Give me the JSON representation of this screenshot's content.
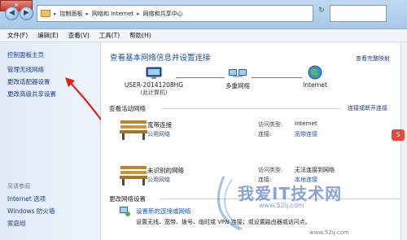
{
  "address": {
    "crumbs": [
      "控制面板",
      "网络和 Internet",
      "网络和共享中心"
    ]
  },
  "menu": [
    "文件(F)",
    "编辑(E)",
    "查看(V)",
    "工具(T)",
    "帮助(H)"
  ],
  "left": {
    "home": "控制面板主页",
    "wireless": "管理无线网络",
    "adapter": "更改适配器设置",
    "advanced": "更改高级共享设置",
    "see_also": "另请参阅",
    "internet_options": "Internet 选项",
    "firewall": "Windows 防火墙",
    "homegroup": "家庭组"
  },
  "main": {
    "title": "查看基本网络信息并设置连接",
    "full_map": "查看完整映射",
    "pc_name": "USER-20141208HG",
    "pc_sub": "(此计算机)",
    "multi_net": "多重网络",
    "internet": "Internet",
    "active_title": "查看活动网络",
    "connect_link": "连接或断开连接",
    "networks": [
      {
        "name": "宽带连接",
        "type": "公用网络",
        "access_key": "访问类型:",
        "access_val": "Internet",
        "conn_key": "连接:",
        "conn_val": "宽带连接"
      },
      {
        "name": "未识别的网络",
        "type": "公用网络",
        "access_key": "访问类型:",
        "access_val": "无法连接到网络",
        "conn_key": "连接:",
        "conn_val": "本地连接"
      }
    ],
    "change_title": "更改网络设置",
    "change_link": "设置新的连接或网络",
    "change_desc": "设置无线、宽带、拨号、临时或 VPN 连接；或设置路由器或访问点。"
  },
  "watermark": {
    "main": "我爱IT技术网",
    "sub": "www.52ij.com",
    "url": "www.52ij.com"
  }
}
